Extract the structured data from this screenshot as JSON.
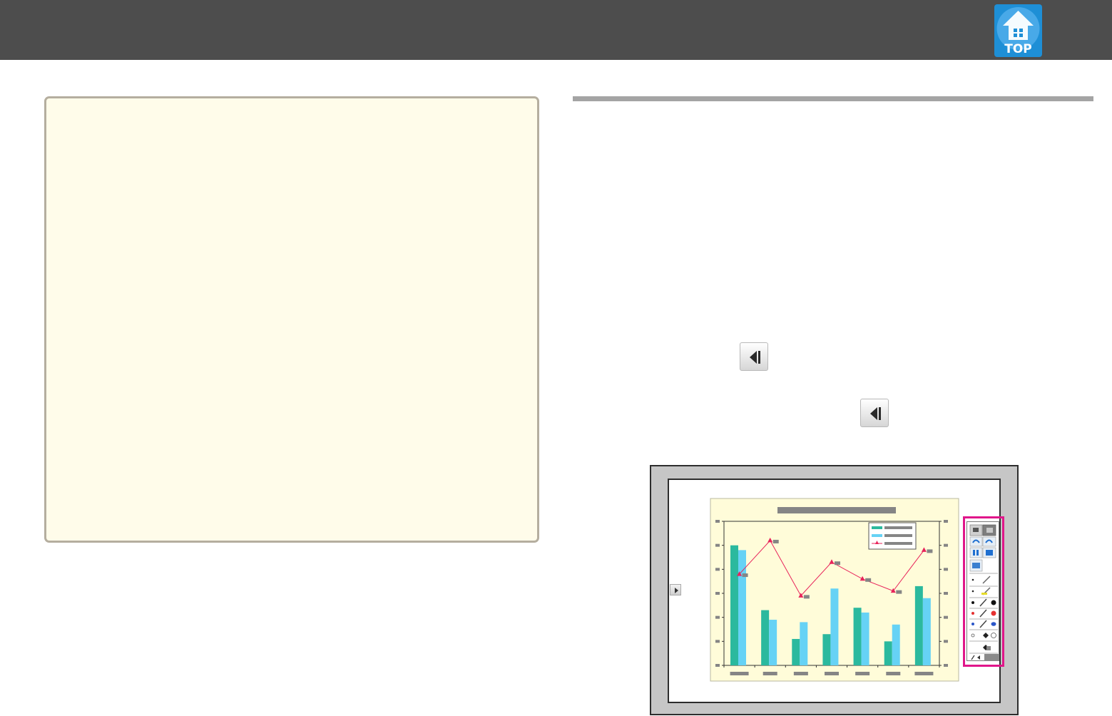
{
  "header": {
    "background_color": "#4d4d4d",
    "top_link": {
      "label": "TOP",
      "icon": "house-arrow-up-icon",
      "color": "#1e8fd6"
    }
  },
  "note": {
    "background_color": "#fffcea",
    "border_color": "#b5ae9f"
  },
  "inline_icons": [
    {
      "name": "show-toolbar-button",
      "icon": "triangle-left-bar-icon"
    },
    {
      "name": "show-toolbar-button",
      "icon": "triangle-left-bar-icon"
    }
  ],
  "figure": {
    "highlight_color": "#e0168a",
    "chart_data": {
      "type": "bar",
      "title": "",
      "legend_placement": "top-right",
      "categories": [
        "",
        "",
        "",
        "",
        "",
        "",
        ""
      ],
      "series": [
        {
          "values": [
            5.0,
            2.3,
            1.1,
            1.3,
            2.4,
            1.0,
            3.3
          ],
          "color": "#2bb99e"
        },
        {
          "values": [
            4.8,
            1.9,
            1.8,
            3.2,
            2.2,
            1.7,
            2.8
          ],
          "color": "#66d2f5"
        },
        {
          "type": "line",
          "values": [
            3.8,
            5.2,
            2.9,
            4.3,
            3.6,
            3.1,
            4.8
          ],
          "color": "#e8245b",
          "marker": "triangle"
        }
      ],
      "ylim": [
        0,
        6
      ],
      "y2lim": [
        0,
        6
      ],
      "grid": false
    },
    "toolbar": {
      "items": [
        "select-icon",
        "print-icon",
        "undo-icon",
        "redo-icon",
        "whiteboard-icon",
        "capture-icon",
        "image-icon",
        "thin-pen-icon",
        "highlighter-icon",
        "black-pen-icon",
        "red-pen-icon",
        "blue-pen-icon",
        "eraser-icon",
        "clear-icon",
        "hide-toolbar-icon"
      ]
    }
  }
}
